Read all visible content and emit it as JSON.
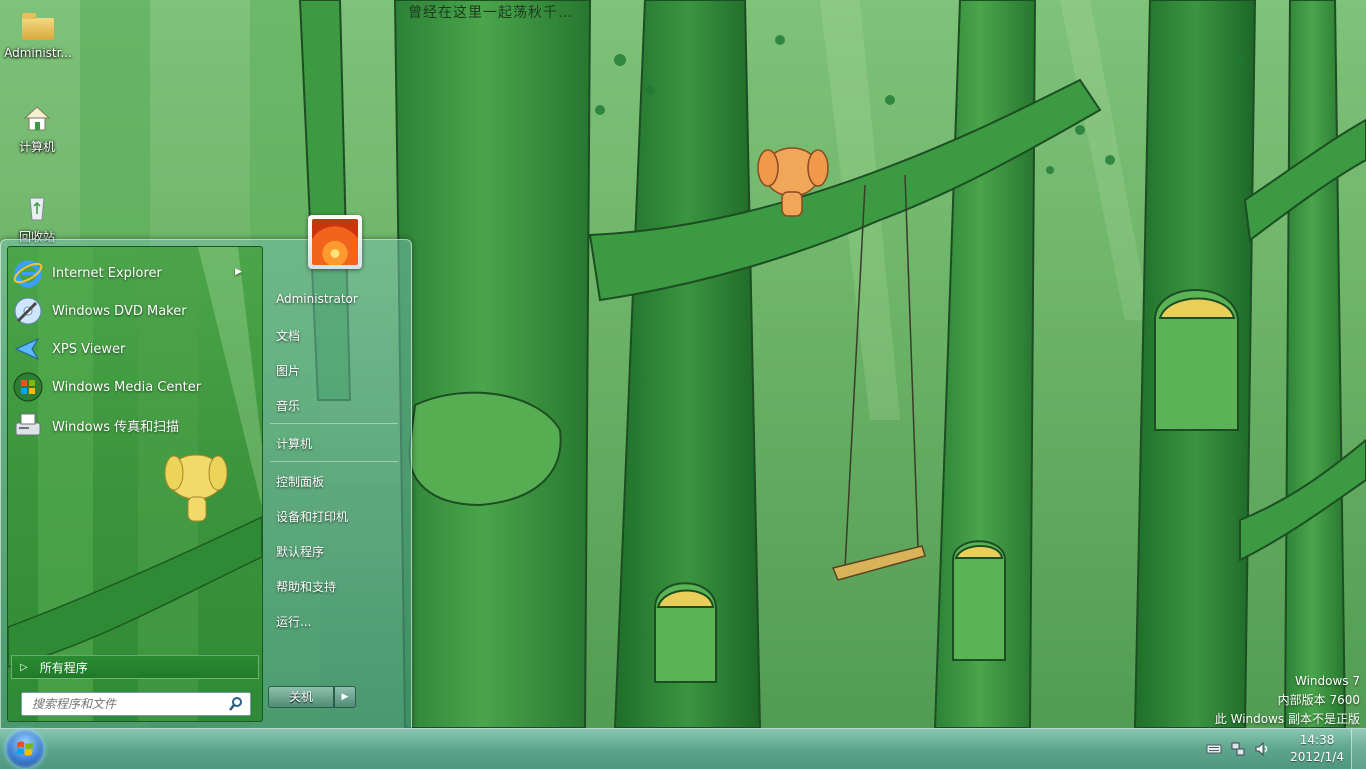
{
  "wallpaper": {
    "caption": "曾经在这里一起荡秋千…",
    "colors": {
      "sky": "#7fc27a",
      "trunk": "#2f8a3a",
      "trunk_light": "#58b055",
      "leaf": "#1f7a33"
    }
  },
  "desktop_icons": [
    {
      "label": "Administr...",
      "icon": "folder-icon"
    },
    {
      "label": "计算机",
      "icon": "computer-icon"
    },
    {
      "label": "回收站",
      "icon": "recycle-bin-icon"
    }
  ],
  "watermark": {
    "line1": "Windows 7",
    "line2": "内部版本 7600",
    "line3": "此 Windows 副本不是正版"
  },
  "start_menu": {
    "programs": [
      {
        "label": "Internet Explorer",
        "icon": "internet-explorer-icon",
        "has_submenu": true
      },
      {
        "label": "Windows DVD Maker",
        "icon": "dvd-maker-icon",
        "has_submenu": false
      },
      {
        "label": "XPS Viewer",
        "icon": "xps-viewer-icon",
        "has_submenu": false
      },
      {
        "label": "Windows Media Center",
        "icon": "media-center-icon",
        "has_submenu": false
      },
      {
        "label": "Windows 传真和扫描",
        "icon": "fax-scan-icon",
        "has_submenu": false
      }
    ],
    "all_programs": "所有程序",
    "search_placeholder": "搜索程序和文件",
    "right_items": {
      "user": "Administrator",
      "documents": "文档",
      "pictures": "图片",
      "music": "音乐",
      "computer": "计算机",
      "control_panel": "控制面板",
      "devices_printers": "设备和打印机",
      "default_programs": "默认程序",
      "help": "帮助和支持",
      "run": "运行..."
    },
    "shutdown_label": "关机"
  },
  "taskbar": {
    "time": "14:38",
    "date": "2012/1/4",
    "tray_icons": [
      "keyboard-icon",
      "network-icon",
      "volume-icon"
    ]
  }
}
